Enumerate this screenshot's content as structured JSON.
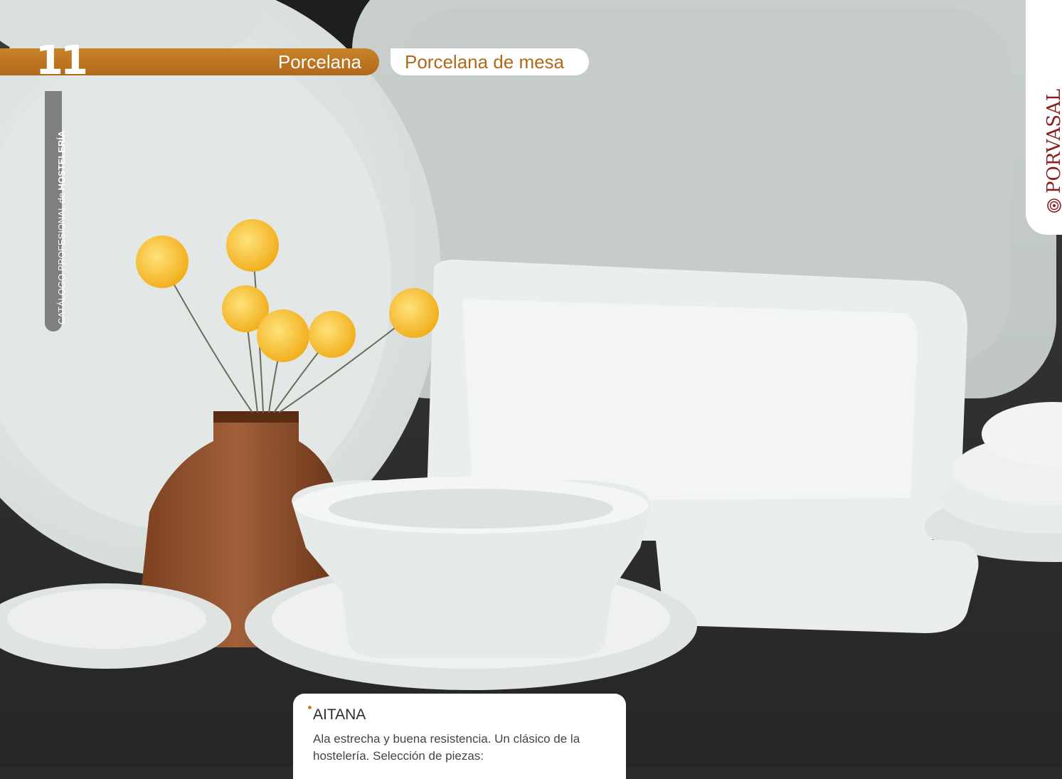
{
  "header": {
    "chapter_number": "11",
    "section": "Porcelana",
    "subsection": "Porcelana de mesa"
  },
  "sidebar": {
    "catalog_prefix": "CATÁLOGO PROFESIONAL de ",
    "catalog_highlight": "HOSTELERÍA"
  },
  "brand": {
    "name": "PORVASAL",
    "icon": "rose-logo-icon"
  },
  "product": {
    "title": "AITANA",
    "description": "Ala estrecha y buena resistencia. Un clásico de la hostelería. Selección de piezas:"
  },
  "colors": {
    "accent": "#b0691b",
    "brand": "#8a1e1e",
    "marker": "#7f7f7f"
  }
}
